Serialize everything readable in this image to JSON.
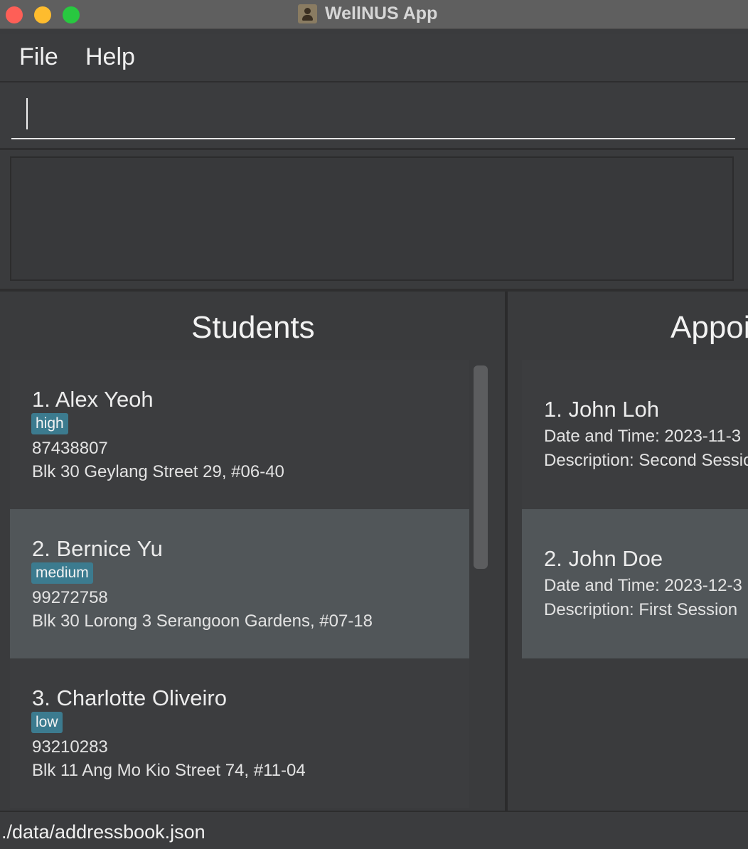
{
  "window": {
    "title": "WellNUS App"
  },
  "menu": {
    "file": "File",
    "help": "Help"
  },
  "command": {
    "value": "",
    "placeholder": ""
  },
  "students": {
    "title": "Students",
    "items": [
      {
        "name": "1.  Alex Yeoh",
        "tag": "high",
        "phone": "87438807",
        "address": "Blk 30 Geylang Street 29, #06-40"
      },
      {
        "name": "2.  Bernice Yu",
        "tag": "medium",
        "phone": "99272758",
        "address": "Blk 30 Lorong 3 Serangoon Gardens, #07-18"
      },
      {
        "name": "3.  Charlotte Oliveiro",
        "tag": "low",
        "phone": "93210283",
        "address": "Blk 11 Ang Mo Kio Street 74, #11-04"
      }
    ]
  },
  "appointments": {
    "title": "Appointments",
    "items": [
      {
        "name": "1.  John Loh",
        "datetime": "Date and Time: 2023-11-3",
        "description": "Description: Second Session"
      },
      {
        "name": "2.  John Doe",
        "datetime": "Date and Time: 2023-12-3",
        "description": "Description: First Session"
      }
    ]
  },
  "status": {
    "path": "./data/addressbook.json"
  },
  "colors": {
    "tag": "#3c7b8f",
    "selected_card": "#515659",
    "background": "#3a3b3d"
  }
}
